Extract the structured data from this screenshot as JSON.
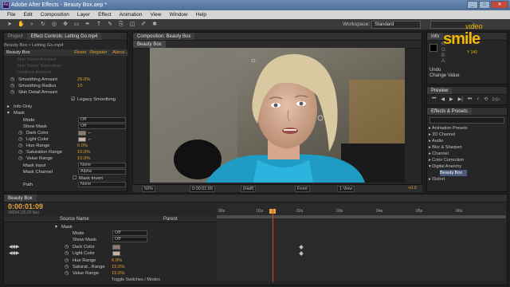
{
  "window": {
    "title": "Adobe After Effects - Beauty Box.aep *",
    "app_badge": "Ae",
    "min": "_",
    "max": "□",
    "close": "✕"
  },
  "menu": [
    "File",
    "Edit",
    "Composition",
    "Layer",
    "Effect",
    "Animation",
    "View",
    "Window",
    "Help"
  ],
  "workspace": {
    "label": "Workspace:",
    "value": "Standard"
  },
  "logo": {
    "brand": "smile",
    "prefix": "video",
    "sub": "Y 140"
  },
  "effect_controls": {
    "tabs": [
      "Project",
      "Effect Controls: Letting Go.mp4"
    ],
    "breadcrumb": "Beauty Box • Letting Go.mp4",
    "effect_name": "Beauty Box",
    "reset": "Reset",
    "register": "Register",
    "about": "About...",
    "faded_rows": [
      "Skin Detail Amount",
      "Skin Detail Saturation",
      "Contrast Amount"
    ],
    "rows": [
      {
        "label": "Smoothing Amount",
        "value": "25.0%"
      },
      {
        "label": "Smoothing Radius",
        "value": "10"
      },
      {
        "label": "Skin Detail Amount",
        "value": ""
      }
    ],
    "legacy_smoothing": "Legacy Smoothing",
    "info_only": "Info Only",
    "mask": "Mask",
    "mask_rows": [
      {
        "label": "Mode",
        "value": "Off",
        "type": "dd"
      },
      {
        "label": "Show Mask",
        "value": "Off",
        "type": "dd"
      },
      {
        "label": "Dark Color",
        "value": "",
        "type": "color"
      },
      {
        "label": "Light Color",
        "value": "",
        "type": "color"
      },
      {
        "label": "Hue Range",
        "value": "6.0%",
        "type": "val"
      },
      {
        "label": "Saturation Range",
        "value": "15.0%",
        "type": "val"
      },
      {
        "label": "Value Range",
        "value": "15.0%",
        "type": "val"
      },
      {
        "label": "Mask Input",
        "value": "None",
        "type": "dd"
      },
      {
        "label": "Mask Channel",
        "value": "Alpha",
        "type": "dd"
      },
      {
        "label": "",
        "value": "Mask Invert",
        "type": "check"
      },
      {
        "label": "Path",
        "value": "None",
        "type": "dd"
      }
    ]
  },
  "composition": {
    "tab": "Composition: Beauty Box",
    "subtab": "Beauty Box",
    "bar": {
      "zoom": "50%",
      "time": "0:00:01:09",
      "res": "(Half)",
      "view": "Front",
      "views": "1 View",
      "exposure": "+0.0"
    }
  },
  "info": {
    "tab": "Info",
    "rgba": [
      "R:",
      "G:",
      "B:",
      "A:"
    ],
    "xy": [
      "X: 1148",
      "Y: 140"
    ],
    "undo": "Undo",
    "undo_action": "Change Value"
  },
  "preview": {
    "tab": "Preview"
  },
  "effects_presets": {
    "tab": "Effects & Presets",
    "items": [
      "Animation Presets",
      "3D Channel",
      "Audio",
      "Blur & Sharpen",
      "Channel",
      "Color Correction",
      "Digital Anarchy",
      "Beauty Box",
      "Distort"
    ]
  },
  "timeline": {
    "tab": "Beauty Box",
    "timecode": "0:00:01:09",
    "timecode_sub": "00034 (25.00 fps)",
    "header": {
      "source": "Source Name",
      "parent": "Parent"
    },
    "ticks": [
      "00s",
      "01s",
      "02s",
      "03s",
      "04s",
      "05s",
      "06s"
    ],
    "rows": [
      {
        "label": "Mask",
        "value": "",
        "type": "group"
      },
      {
        "label": "Mode",
        "value": "Off",
        "type": "dd"
      },
      {
        "label": "Show Mask",
        "value": "Off",
        "type": "dd"
      },
      {
        "label": "Dark Color",
        "value": "",
        "type": "color"
      },
      {
        "label": "Light Color",
        "value": "",
        "type": "color"
      },
      {
        "label": "Hue Range",
        "value": "6.0%",
        "type": "val"
      },
      {
        "label": "Saturat...Range",
        "value": "15.0%",
        "type": "val"
      },
      {
        "label": "Value Range",
        "value": "15.0%",
        "type": "val"
      }
    ],
    "toggle": "Toggle Switches / Modes"
  },
  "colors": {
    "accent": "#e0a030",
    "playhead": "#d24434",
    "brand": "#f2b705"
  }
}
